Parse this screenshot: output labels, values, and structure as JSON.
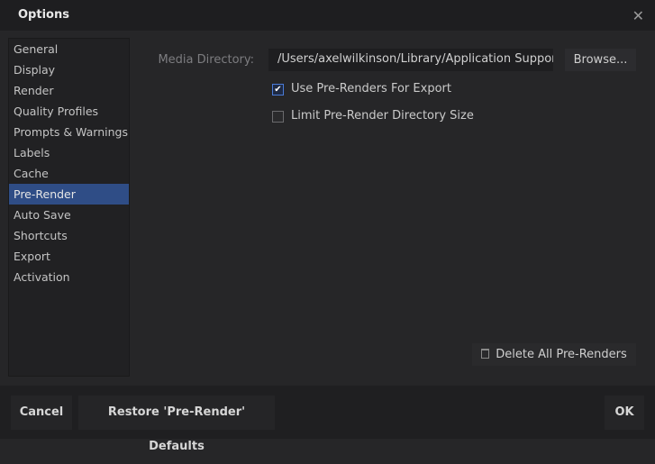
{
  "window": {
    "title": "Options"
  },
  "sidebar": {
    "items": [
      {
        "label": "General"
      },
      {
        "label": "Display"
      },
      {
        "label": "Render"
      },
      {
        "label": "Quality Profiles"
      },
      {
        "label": "Prompts & Warnings"
      },
      {
        "label": "Labels"
      },
      {
        "label": "Cache"
      },
      {
        "label": "Pre-Render",
        "selected": true
      },
      {
        "label": "Auto Save"
      },
      {
        "label": "Shortcuts"
      },
      {
        "label": "Export"
      },
      {
        "label": "Activation"
      }
    ]
  },
  "main": {
    "media_label": "Media Directory:",
    "media_value": "/Users/axelwilkinson/Library/Application Support",
    "browse": "Browse...",
    "use_prerenders": {
      "label": "Use Pre-Renders For Export",
      "checked": true
    },
    "limit_size": {
      "label": "Limit Pre-Render Directory Size",
      "checked": false
    },
    "delete_all": "Delete All Pre-Renders"
  },
  "footer": {
    "cancel": "Cancel",
    "restore": "Restore 'Pre-Render' Defaults",
    "ok": "OK"
  },
  "colors": {
    "selected": "#2f4d86",
    "checkbox": "#4a7bd8"
  }
}
